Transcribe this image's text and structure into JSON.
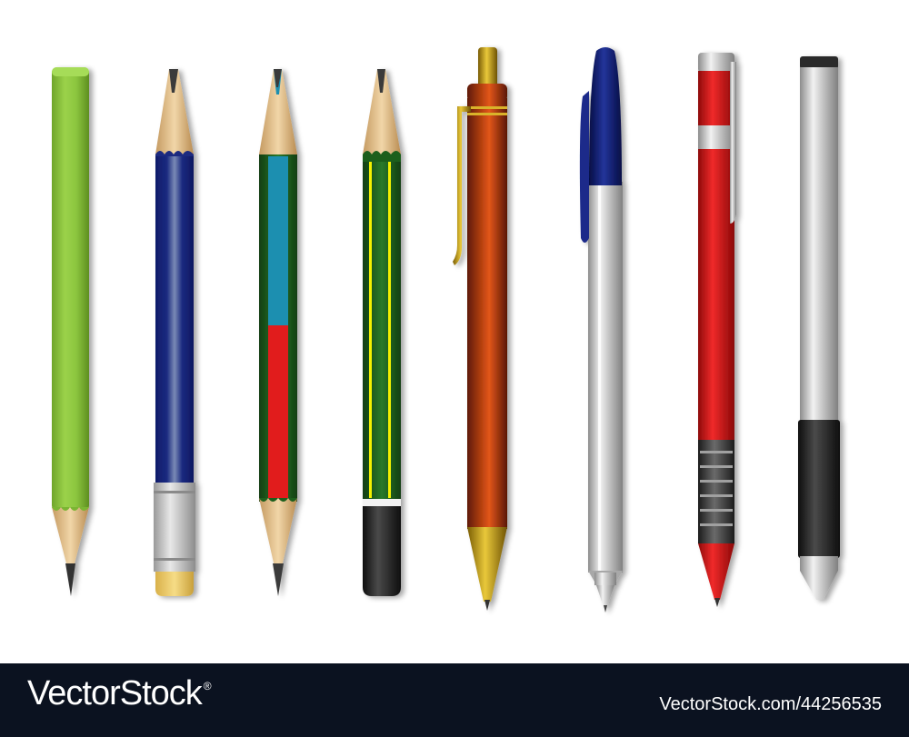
{
  "footer": {
    "brand": "VectorStock",
    "registered_mark": "®",
    "url_id": "VectorStock.com/44256535"
  },
  "items": [
    {
      "name": "green pencil"
    },
    {
      "name": "blue pencil with eraser"
    },
    {
      "name": "bicolor pencil blue red"
    },
    {
      "name": "green pencil yellow stripes"
    },
    {
      "name": "brown click ballpoint pen"
    },
    {
      "name": "silver capped ballpoint pen"
    },
    {
      "name": "red click pen"
    },
    {
      "name": "silver marker"
    }
  ],
  "colors": {
    "footer_bg": "#0b1220",
    "wood": "#e3c08f",
    "graphite": "#3a3a3a",
    "pencil_green": "#8cc63f",
    "pencil_navy": "#1b2a80",
    "pencil_teal": "#1b8fb0",
    "pencil_red": "#e11d1d",
    "pencil_dark_green": "#1e5e1e",
    "stripe_yellow": "#f4f000",
    "pen_brown": "#a7330e",
    "pen_cap_blue": "#0b1b6a",
    "pen_red": "#d61414",
    "silver": "#c8c8c8"
  }
}
